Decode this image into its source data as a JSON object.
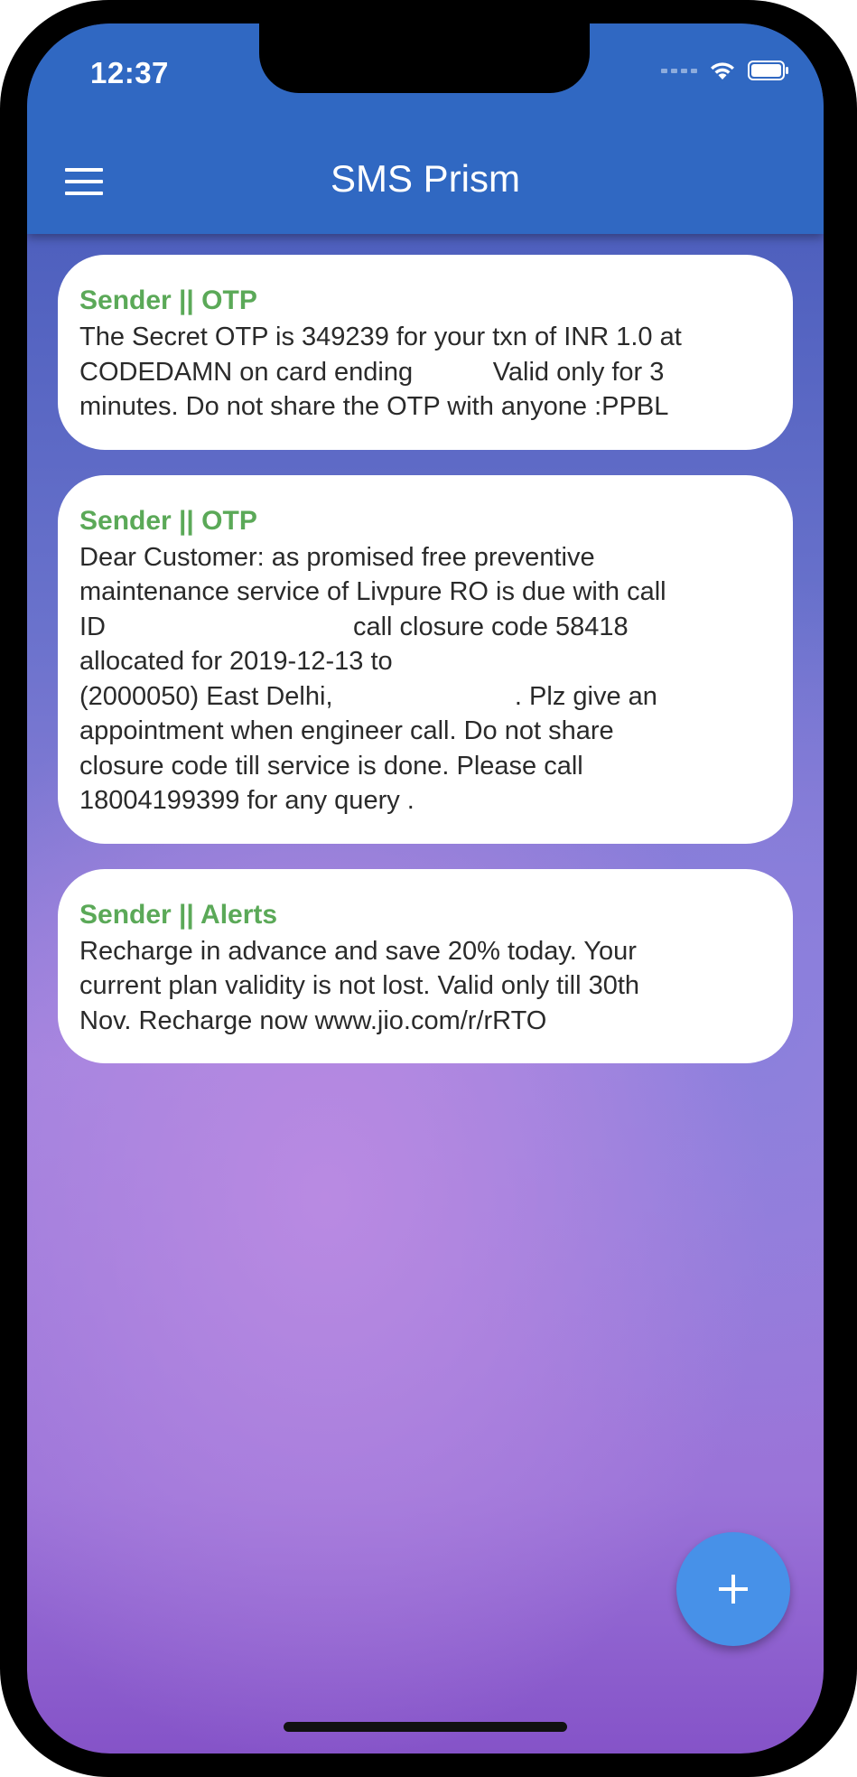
{
  "status_bar": {
    "time": "12:37"
  },
  "app_bar": {
    "title": "SMS Prism",
    "menu_icon": "hamburger-menu-icon"
  },
  "messages": [
    {
      "title": "Sender || OTP",
      "body": "The Secret OTP is 349239 for your txn of INR 1.0 at\nCODEDAMN on card ending           Valid only for 3\nminutes. Do not share the OTP with anyone :PPBL"
    },
    {
      "title": "Sender || OTP",
      "body": "Dear Customer: as promised free preventive\nmaintenance service of Livpure RO is due with call\nID                                  call closure code 58418\nallocated for 2019-12-13 to\n(2000050) East Delhi,                         . Plz give an\nappointment when engineer call. Do not share\nclosure code till service is done. Please call\n18004199399 for any query ."
    },
    {
      "title": "Sender || Alerts",
      "body": "Recharge in advance and save 20% today. Your\ncurrent plan validity is not lost. Valid only till 30th\nNov. Recharge now www.jio.com/r/rRTO"
    }
  ],
  "fab": {
    "icon": "plus-icon"
  },
  "colors": {
    "app_bar": "#3068c2",
    "sender_title": "#5ba958",
    "fab": "#4791e8"
  }
}
